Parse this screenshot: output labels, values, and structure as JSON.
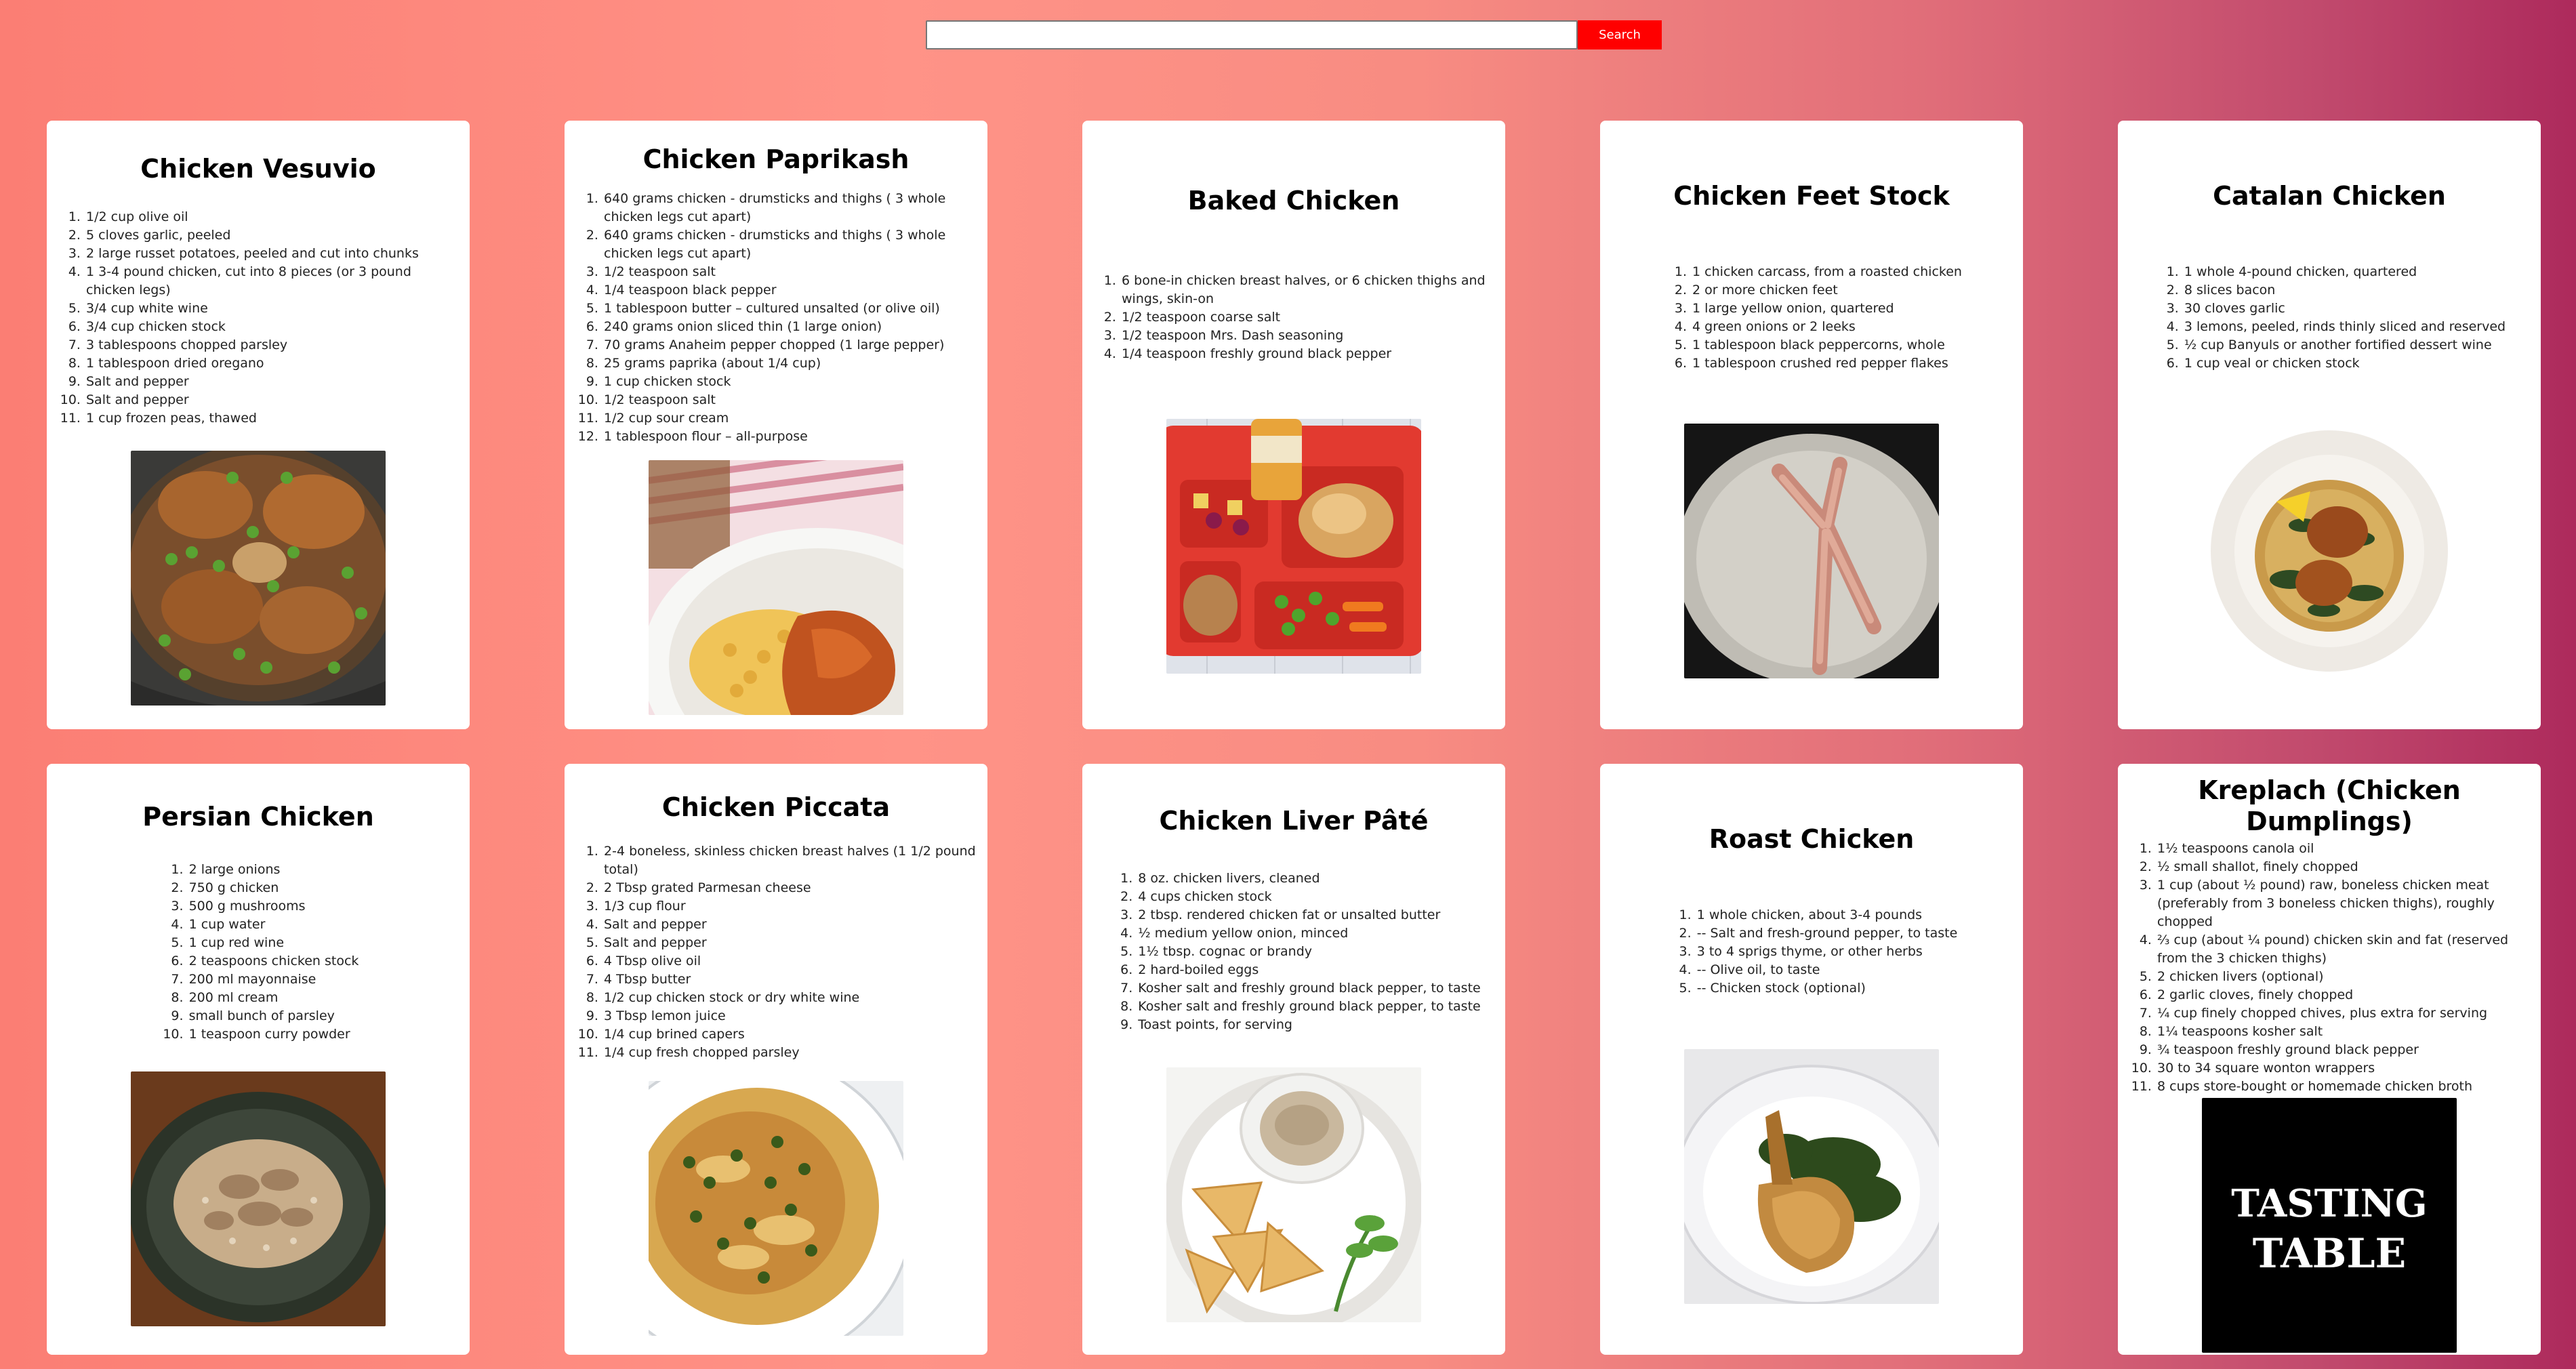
{
  "search": {
    "placeholder": "",
    "value": "",
    "button_label": "Search"
  },
  "colors": {
    "accent": "#ff0000",
    "card_bg": "#ffffff",
    "bg_left": "#fb7e74",
    "bg_right": "#ad2a5c"
  },
  "recipes": [
    {
      "title": "Chicken Vesuvio",
      "ingredients": [
        "1/2 cup olive oil",
        "5 cloves garlic, peeled",
        "2 large russet potatoes, peeled and cut into chunks",
        "1 3-4 pound chicken, cut into 8 pieces (or 3 pound chicken legs)",
        "3/4 cup white wine",
        "3/4 cup chicken stock",
        "3 tablespoons chopped parsley",
        "1 tablespoon dried oregano",
        "Salt and pepper",
        "Salt and pepper",
        "1 cup frozen peas, thawed"
      ],
      "image": "chicken-vesuvio-photo"
    },
    {
      "title": "Chicken Paprikash",
      "ingredients": [
        "640 grams chicken - drumsticks and thighs ( 3 whole chicken legs cut apart)",
        "640 grams chicken - drumsticks and thighs ( 3 whole chicken legs cut apart)",
        "1/2 teaspoon salt",
        "1/4 teaspoon black pepper",
        "1 tablespoon butter – cultured unsalted (or olive oil)",
        "240 grams onion sliced thin (1 large onion)",
        "70 grams Anaheim pepper chopped (1 large pepper)",
        "25 grams paprika (about 1/4 cup)",
        "1 cup chicken stock",
        "1/2 teaspoon salt",
        "1/2 cup sour cream",
        "1 tablespoon flour – all-purpose"
      ],
      "image": "chicken-paprikash-photo"
    },
    {
      "title": "Baked Chicken",
      "ingredients": [
        "6 bone-in chicken breast halves, or 6 chicken thighs and wings, skin-on",
        "1/2 teaspoon coarse salt",
        "1/2 teaspoon Mrs. Dash seasoning",
        "1/4 teaspoon freshly ground black pepper"
      ],
      "image": "baked-chicken-tray-photo"
    },
    {
      "title": "Chicken Feet Stock",
      "ingredients": [
        "1 chicken carcass, from a roasted chicken",
        "2 or more chicken feet",
        "1 large yellow onion, quartered",
        "4 green onions or 2 leeks",
        "1 tablespoon black peppercorns, whole",
        "1 tablespoon crushed red pepper flakes"
      ],
      "image": "chicken-feet-photo"
    },
    {
      "title": "Catalan Chicken",
      "ingredients": [
        "1 whole 4-pound chicken, quartered",
        "8 slices bacon",
        "30 cloves garlic",
        "3 lemons, peeled, rinds thinly sliced and reserved",
        "½ cup Banyuls or another fortified dessert wine",
        "1 cup veal or chicken stock"
      ],
      "image": "catalan-chicken-photo"
    },
    {
      "title": "Persian Chicken",
      "ingredients": [
        "2 large onions",
        "750 g chicken",
        "500 g mushrooms",
        "1 cup water",
        "1 cup red wine",
        "2 teaspoons chicken stock",
        "200 ml mayonnaise",
        "200 ml cream",
        "small bunch of parsley",
        "1 teaspoon curry powder"
      ],
      "image": "persian-chicken-photo"
    },
    {
      "title": "Chicken Piccata",
      "ingredients": [
        "2-4 boneless, skinless chicken breast halves (1 1/2 pound total)",
        "2 Tbsp grated Parmesan cheese",
        "1/3 cup flour",
        "Salt and pepper",
        "Salt and pepper",
        "4 Tbsp olive oil",
        "4 Tbsp butter",
        "1/2 cup chicken stock or dry white wine",
        "3 Tbsp lemon juice",
        "1/4 cup brined capers",
        "1/4 cup fresh chopped parsley"
      ],
      "image": "chicken-piccata-photo"
    },
    {
      "title": "Chicken Liver Pâté",
      "ingredients": [
        "8 oz. chicken livers, cleaned",
        "4 cups chicken stock",
        "2 tbsp. rendered chicken fat or unsalted butter",
        "½ medium yellow onion, minced",
        "1½ tbsp. cognac or brandy",
        "2 hard-boiled eggs",
        "Kosher salt and freshly ground black pepper, to taste",
        "Kosher salt and freshly ground black pepper, to taste",
        "Toast points, for serving"
      ],
      "image": "chicken-liver-pate-photo"
    },
    {
      "title": "Roast Chicken",
      "ingredients": [
        "1 whole chicken, about 3-4 pounds",
        "-- Salt and fresh-ground pepper, to taste",
        "3 to 4 sprigs thyme, or other herbs",
        "-- Olive oil, to taste",
        "-- Chicken stock (optional)"
      ],
      "image": "roast-chicken-photo"
    },
    {
      "title": "Kreplach (Chicken Dumplings)",
      "ingredients": [
        "1½ teaspoons canola oil",
        "½ small shallot, finely chopped",
        "1 cup (about ½ pound) raw, boneless chicken meat (preferably from 3 boneless chicken thighs), roughly chopped",
        "⅔ cup (about ¼ pound) chicken skin and fat (reserved from the 3 chicken thighs)",
        "2 chicken livers (optional)",
        "2 garlic cloves, finely chopped",
        "¼ cup finely chopped chives, plus extra for serving",
        "1¼ teaspoons kosher salt",
        "¾ teaspoon freshly ground black pepper",
        "30 to 34 square wonton wrappers",
        "8 cups store-bought or homemade chicken broth"
      ],
      "image": "tasting-table-logo",
      "logo_text": [
        "TASTING",
        "TABLE"
      ]
    }
  ]
}
